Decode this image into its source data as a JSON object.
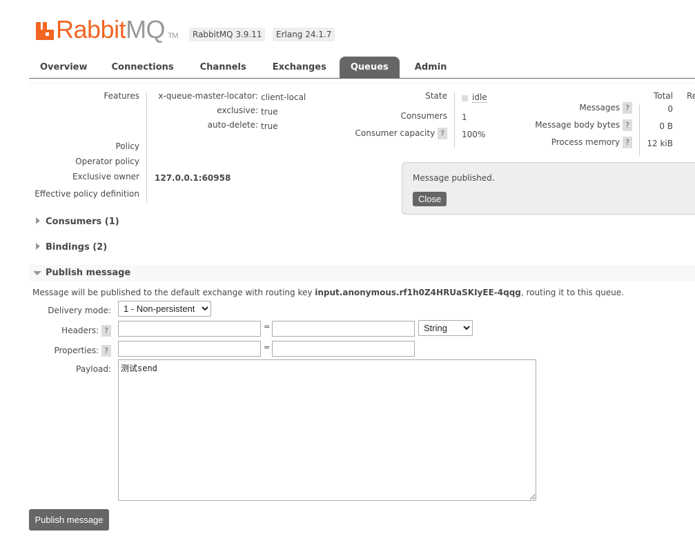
{
  "header": {
    "logo_text_1": "Rabbit",
    "logo_text_2": "MQ",
    "logo_tm": "TM",
    "rabbitmq_version": "RabbitMQ 3.9.11",
    "erlang_version": "Erlang 24.1.7"
  },
  "colors": {
    "brand": "#f26522",
    "tab_active": "#666666"
  },
  "tabs": [
    {
      "label": "Overview"
    },
    {
      "label": "Connections"
    },
    {
      "label": "Channels"
    },
    {
      "label": "Exchanges"
    },
    {
      "label": "Queues",
      "active": true
    },
    {
      "label": "Admin"
    }
  ],
  "details": {
    "features_label": "Features",
    "features": [
      {
        "key": "x-queue-master-locator:",
        "value": "client-local"
      },
      {
        "key": "exclusive:",
        "value": "true"
      },
      {
        "key": "auto-delete:",
        "value": "true"
      }
    ],
    "policy_label": "Policy",
    "operator_policy_label": "Operator policy",
    "exclusive_owner_label": "Exclusive owner",
    "exclusive_owner": "127.0.0.1:60958",
    "effective_policy_label": "Effective policy definition",
    "state_label": "State",
    "state": "idle",
    "consumers_label": "Consumers",
    "consumers": "1",
    "consumer_capacity_label": "Consumer capacity",
    "consumer_capacity": "100%",
    "total_header": "Total",
    "ready_header": "Re",
    "stats": [
      {
        "label": "Messages",
        "value": "0"
      },
      {
        "label": "Message body bytes",
        "value": "0 B"
      },
      {
        "label": "Process memory",
        "value": "12 kiB"
      }
    ],
    "help": "?"
  },
  "flash": {
    "message": "Message published.",
    "close_label": "Close"
  },
  "sections": {
    "consumers": "Consumers (1)",
    "bindings": "Bindings (2)",
    "publish": "Publish message"
  },
  "publish": {
    "info_prefix": "Message will be published to the default exchange with routing key ",
    "routing_key": "input.anonymous.rf1h0Z4HRUaSKIyEE-4qqg",
    "info_suffix": ", routing it to this queue.",
    "delivery_mode_label": "Delivery mode:",
    "delivery_mode": "1 - Non-persistent",
    "headers_label": "Headers:",
    "header_type": "String",
    "properties_label": "Properties:",
    "eq": "=",
    "payload_label": "Payload:",
    "payload": "测试send",
    "submit_label": "Publish message"
  }
}
